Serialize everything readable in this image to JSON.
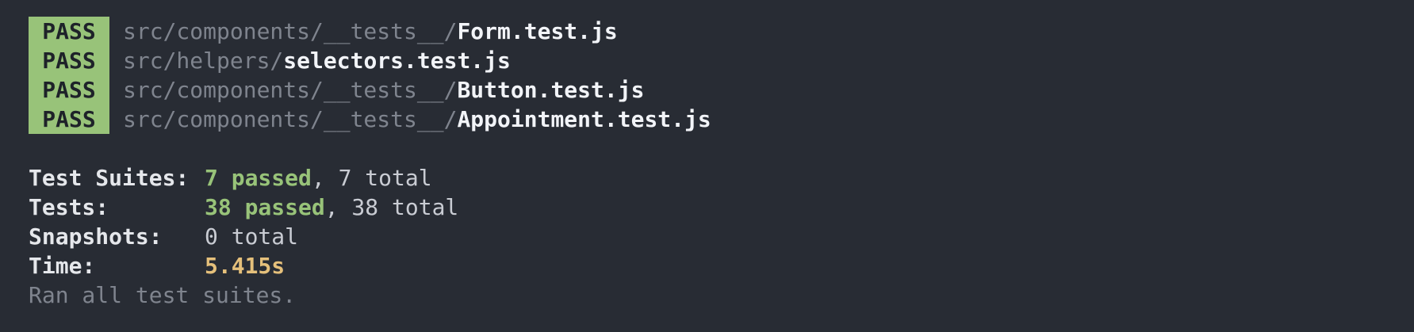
{
  "results": [
    {
      "status": "PASS",
      "dir": "src/components/__tests__/",
      "file": "Form.test.js"
    },
    {
      "status": "PASS",
      "dir": "src/helpers/",
      "file": "selectors.test.js"
    },
    {
      "status": "PASS",
      "dir": "src/components/__tests__/",
      "file": "Button.test.js"
    },
    {
      "status": "PASS",
      "dir": "src/components/__tests__/",
      "file": "Appointment.test.js"
    }
  ],
  "summary": {
    "suites": {
      "label": "Test Suites:",
      "highlight": "7 passed",
      "rest": ", 7 total"
    },
    "tests": {
      "label": "Tests:",
      "highlight": "38 passed",
      "rest": ", 38 total"
    },
    "snapshots": {
      "label": "Snapshots:",
      "value": "0 total"
    },
    "time": {
      "label": "Time:",
      "value": "5.415s"
    },
    "footer": "Ran all test suites."
  },
  "colors": {
    "background": "#282c34",
    "pass_badge": "#98c379",
    "passed_text": "#98c379",
    "time_text": "#e5c07b",
    "muted_text": "#7f848e"
  }
}
